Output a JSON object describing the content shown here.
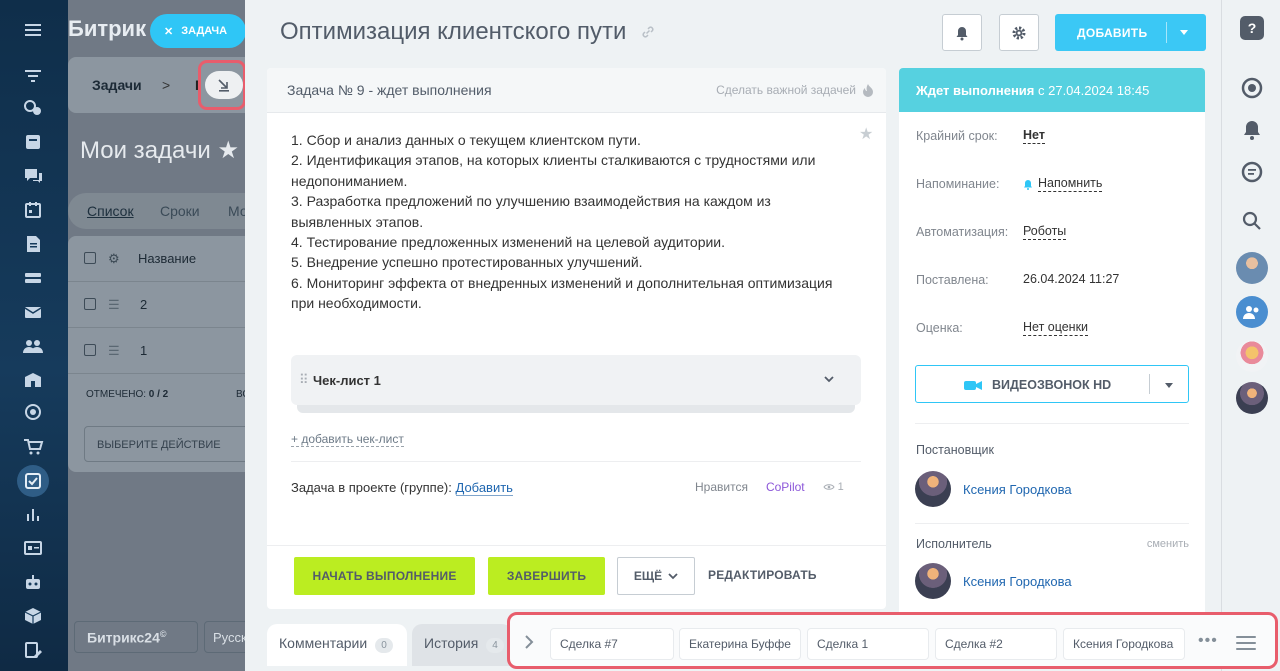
{
  "background": {
    "brand": "Битрик",
    "task_button": "ЗАДАЧА",
    "breadcrumb": "Задачи",
    "breadcrumb_sep": ">",
    "breadcrumb_next": "Г",
    "page_title": "Мои задачи",
    "view_tabs": [
      "Список",
      "Сроки",
      "Мо"
    ],
    "table_header": "Название",
    "rows": [
      "2",
      "1"
    ],
    "marked_label": "ОТМЕЧЕНО:",
    "marked_value": "0 / 2",
    "marked_cut": "ВС",
    "action_select": "ВЫБЕРИТЕ ДЕЙСТВИЕ",
    "footer_logo": "Битрикс24",
    "footer_lang": "Русск"
  },
  "task": {
    "title": "Оптимизация клиентского пути",
    "add_button": "ДОБАВИТЬ",
    "header_label": "Задача № 9 - ждет выполнения",
    "make_important": "Сделать важной задачей",
    "description": [
      "1. Сбор и анализ данных о текущем клиентском пути.",
      "2. Идентификация этапов, на которых клиенты сталкиваются с трудностями или недопониманием.",
      "3. Разработка предложений по улучшению взаимодействия на каждом из выявленных этапов.",
      "4. Тестирование предложенных изменений на целевой аудитории.",
      "5. Внедрение успешно протестированных улучшений.",
      "6. Мониторинг эффекта от внедренных изменений и дополнительная оптимизация при необходимости."
    ],
    "checklist_title": "Чек-лист 1",
    "add_checklist": "+ добавить чек-лист",
    "project_label": "Задача в проекте (группе):",
    "project_link": "Добавить",
    "like_label": "Нравится",
    "like_user": "CoPilot",
    "views": "1",
    "buttons": {
      "start": "НАЧАТЬ ВЫПОЛНЕНИЕ",
      "finish": "ЗАВЕРШИТЬ",
      "more": "ЕЩЁ",
      "edit": "РЕДАКТИРОВАТЬ"
    },
    "tabs": [
      {
        "label": "Комментарии",
        "count": "0"
      },
      {
        "label": "История",
        "count": "4"
      }
    ]
  },
  "sidebar": {
    "status_bold": "Ждет выполнения",
    "status_rest": "с 27.04.2024 18:45",
    "props": [
      {
        "label": "Крайний срок:",
        "value": "Нет"
      },
      {
        "label": "Напоминание:",
        "value": "Напомнить"
      },
      {
        "label": "Автоматизация:",
        "value": "Роботы"
      },
      {
        "label": "Поставлена:",
        "value": "26.04.2024 11:27"
      },
      {
        "label": "Оценка:",
        "value": "Нет оценки"
      }
    ],
    "video_call": "ВИДЕОЗВОНОК HD",
    "creator_label": "Постановщик",
    "creator_name": "Ксения Городкова",
    "assignee_label": "Исполнитель",
    "change_label": "сменить",
    "assignee_name": "Ксения Городкова"
  },
  "quick_access": {
    "items": [
      "Сделка #7",
      "Екатерина Буффе",
      "Сделка 1",
      "Сделка #2",
      "Ксения Городкова"
    ]
  },
  "colors": {
    "accent_blue": "#3bc8f5",
    "status_teal": "#56d1e0",
    "green_button": "#bbed21",
    "highlight_red": "#e85d6c"
  }
}
